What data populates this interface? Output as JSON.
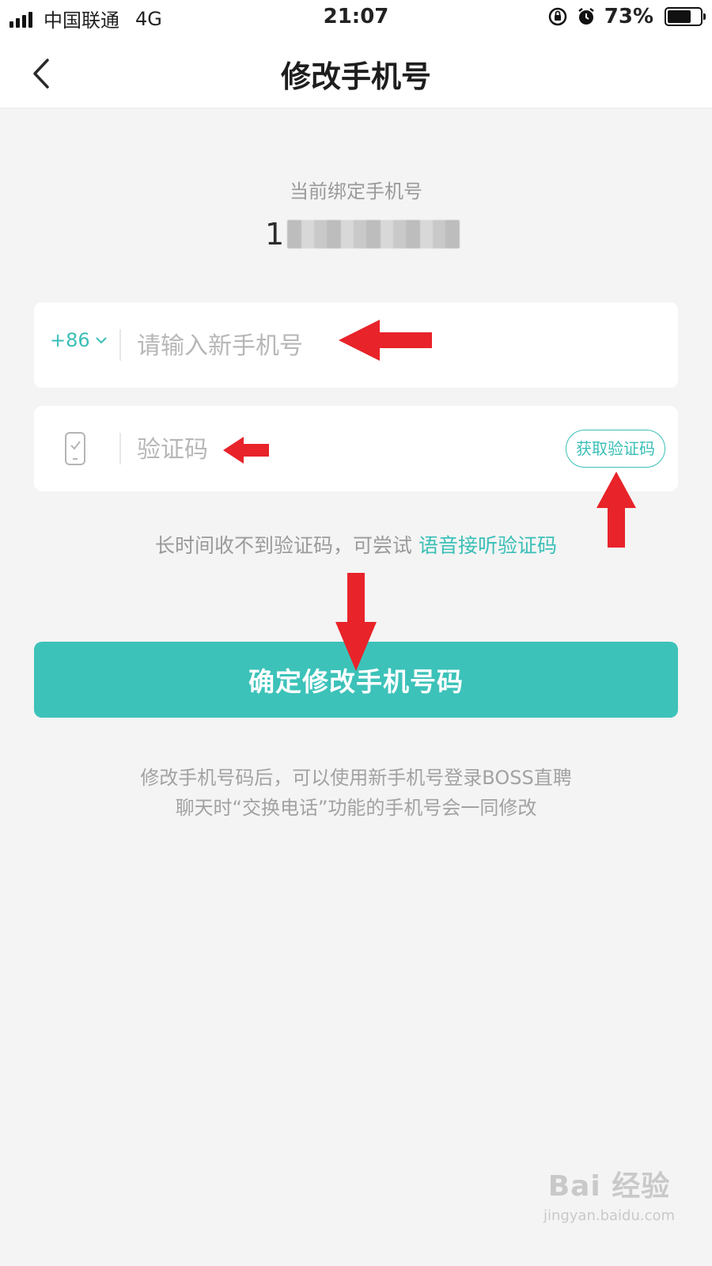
{
  "status_bar": {
    "carrier": "中国联通",
    "network": "4G",
    "time": "21:07",
    "battery_percent": "73%",
    "battery_level": 0.73,
    "icons": [
      "signal-icon",
      "rotation-lock-icon",
      "alarm-icon",
      "battery-icon"
    ]
  },
  "nav": {
    "back_icon": "chevron-left-icon",
    "title": "修改手机号"
  },
  "current": {
    "label": "当前绑定手机号",
    "number_visible": "1"
  },
  "phone_field": {
    "country_code": "+86",
    "placeholder": "请输入新手机号"
  },
  "code_field": {
    "icon": "phone-check-icon",
    "placeholder": "验证码",
    "get_code_label": "获取验证码"
  },
  "hint": {
    "text": "长时间收不到验证码，可尝试",
    "link": "语音接听验证码"
  },
  "confirm": {
    "label": "确定修改手机号码"
  },
  "footnote": {
    "line1": "修改手机号码后，可以使用新手机号登录BOSS直聘",
    "line2": "聊天时“交换电话”功能的手机号会一同修改"
  },
  "watermark": {
    "brand": "Bai 经验",
    "url": "jingyan.baidu.com"
  },
  "colors": {
    "accent": "#3cc2b9",
    "annotation_arrow": "#e8232a",
    "background": "#f4f4f4"
  }
}
